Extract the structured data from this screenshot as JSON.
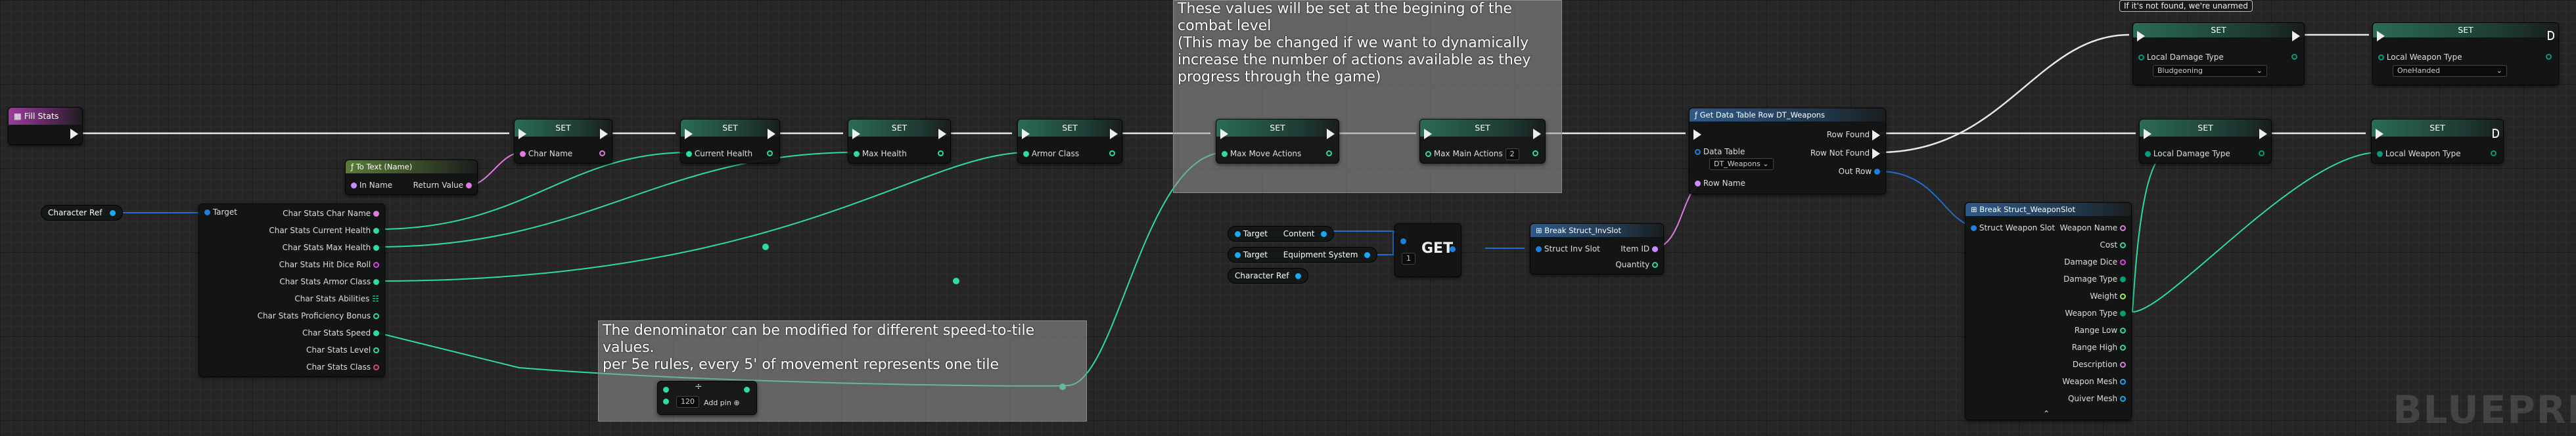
{
  "comments": {
    "top": [
      "These values will be set at the begining of the",
      "combat level",
      "(This may be changed if we want to dynamically",
      "increase the number of actions available as they",
      "progress through the game)"
    ],
    "bottom": [
      "The denominator can be modified for different speed-to-tile",
      "values.",
      "per 5e rules, every 5' of movement represents one tile"
    ]
  },
  "fill_stats": {
    "title": "Fill Stats"
  },
  "char_ref": {
    "label": "Character Ref"
  },
  "char_ref2": {
    "label": "Character Ref"
  },
  "break_stats": {
    "target": "Target",
    "outputs": [
      "Char Stats Char Name",
      "Char Stats Current Health",
      "Char Stats Max Health",
      "Char Stats Hit Dice Roll",
      "Char Stats Armor Class",
      "Char Stats Abilities",
      "Char Stats Proficiency Bonus",
      "Char Stats Speed",
      "Char Stats Level",
      "Char Stats Class"
    ]
  },
  "to_text": {
    "title": "To Text (Name)",
    "in": "In Name",
    "out": "Return Value"
  },
  "set_nodes": [
    {
      "title": "SET",
      "pin": "Char Name"
    },
    {
      "title": "SET",
      "pin": "Current Health"
    },
    {
      "title": "SET",
      "pin": "Max Health"
    },
    {
      "title": "SET",
      "pin": "Armor Class"
    },
    {
      "title": "SET",
      "pin": "Max Move Actions"
    },
    {
      "title": "SET",
      "pin": "Max Main Actions",
      "value": "2"
    }
  ],
  "get_node": {
    "label": "GET",
    "index": "1"
  },
  "targets": [
    {
      "target": "Target",
      "label": "Content"
    },
    {
      "target": "Target",
      "label": "Equipment System"
    }
  ],
  "break_inv": {
    "title": "Break Struct_InvSlot",
    "in": "Struct Inv Slot",
    "out1": "Item ID",
    "out2": "Quantity"
  },
  "datatable": {
    "title": "Get Data Table Row DT_Weapons",
    "table_label": "Data Table",
    "table_value": "DT_Weapons",
    "row_name": "Row Name",
    "found": "Row Found",
    "not_found": "Row Not Found",
    "out_row": "Out Row"
  },
  "break_weapon": {
    "title": "Break Struct_WeaponSlot",
    "in": "Struct Weapon Slot",
    "outputs": [
      "Weapon Name",
      "Cost",
      "Damage Dice",
      "Damage Type",
      "Weight",
      "Weapon Type",
      "Range Low",
      "Range High",
      "Description",
      "Weapon Mesh",
      "Quiver Mesh"
    ]
  },
  "divide": {
    "value": "120",
    "add_pin": "Add pin"
  },
  "tooltip": "If it's not found, we're unarmed",
  "set_top": [
    {
      "title": "SET",
      "pin": "Local Damage Type",
      "value": "Bludgeoning"
    },
    {
      "title": "SET",
      "pin": "Local Weapon Type",
      "value": "OneHanded"
    }
  ],
  "set_bottom": [
    {
      "title": "SET",
      "pin": "Local Damage Type"
    },
    {
      "title": "SET",
      "pin": "Local Weapon Type"
    }
  ],
  "watermark": "BLUEPRI",
  "colors": {
    "exec": "#ffffff",
    "text_pin": "#e07ae0",
    "int_pin": "#2fdca0",
    "struct_pin": "#1e7fe0",
    "name_pin": "#c88cff",
    "byte_pin": "#0a6b5a",
    "object_pin": "#1aa8f0"
  }
}
